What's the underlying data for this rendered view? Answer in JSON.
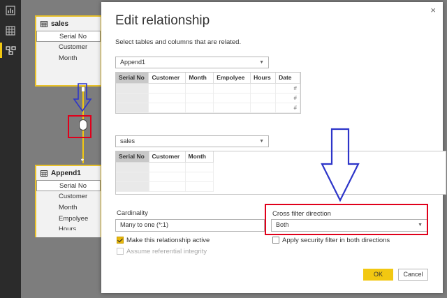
{
  "colors": {
    "accent": "#f2c811",
    "annotation_red": "#e0001b",
    "annotation_blue": "#2d35c9"
  },
  "rail": {
    "icons": [
      "report-view-icon",
      "data-view-icon",
      "relationship-view-icon"
    ],
    "active": "relationship-view-icon"
  },
  "canvas": {
    "sales_table": {
      "name": "sales",
      "fields": [
        "Serial No",
        "Customer",
        "Month"
      ],
      "selected": "Serial No"
    },
    "append_table": {
      "name": "Append1",
      "fields": [
        "Serial No",
        "Customer",
        "Month",
        "Empolyee",
        "Hours"
      ],
      "selected": "Serial No"
    },
    "one_side": "1",
    "many_side": "*"
  },
  "dialog": {
    "title": "Edit relationship",
    "subtitle": "Select tables and columns that are related.",
    "close_glyph": "×",
    "table1": {
      "name": "Append1",
      "columns": [
        "Serial No",
        "Customer",
        "Month",
        "Empolyee",
        "Hours",
        "Date"
      ],
      "selected_column": "Serial No",
      "row_values": [
        "#",
        "#",
        "#"
      ]
    },
    "table2": {
      "name": "sales",
      "columns": [
        "Serial No",
        "Customer",
        "Month"
      ],
      "selected_column": "Serial No"
    },
    "cardinality": {
      "label": "Cardinality",
      "value": "Many to one (*:1)"
    },
    "cross_filter": {
      "label": "Cross filter direction",
      "value": "Both"
    },
    "make_active": {
      "label": "Make this relationship active",
      "checked": true
    },
    "security_filter": {
      "label": "Apply security filter in both directions",
      "checked": false
    },
    "referential_integrity": {
      "label": "Assume referential integrity",
      "checked": false,
      "disabled": true
    },
    "ok_label": "OK",
    "cancel_label": "Cancel"
  }
}
